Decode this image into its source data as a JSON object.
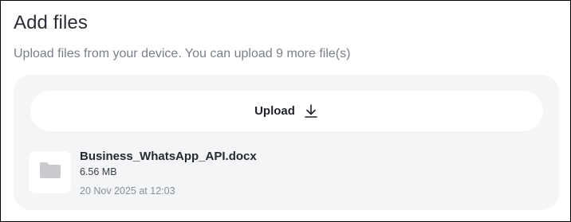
{
  "header": {
    "title": "Add files",
    "subtitle": "Upload files from your device. You can upload 9 more file(s)"
  },
  "upload": {
    "label": "Upload",
    "icon": "download-arrow-icon"
  },
  "files": [
    {
      "name": "Business_WhatsApp_API.docx",
      "size": "6.56 MB",
      "date": "20 Nov 2025 at 12:03",
      "icon": "folder-icon"
    }
  ],
  "colors": {
    "panel_bg": "#f4f5f6",
    "title_text": "#2a2d34",
    "muted_text": "#7a7f88",
    "folder_icon": "#c9cbcf"
  }
}
